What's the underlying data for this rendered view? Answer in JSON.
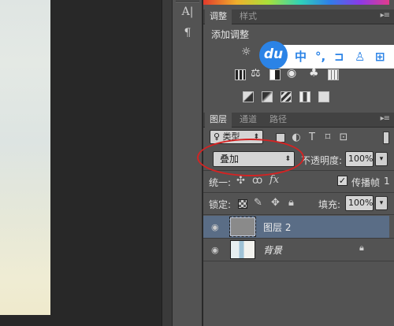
{
  "colors": {
    "panel_bg": "#535353",
    "selected_row": "#5a6d86",
    "annotation": "#d42323",
    "baidu_blue": "#2b83e6"
  },
  "tool_column": {
    "items": [
      {
        "icon": "character-icon",
        "glyph": "A|"
      },
      {
        "icon": "paragraph-icon",
        "glyph": "¶"
      }
    ]
  },
  "adjustments_panel": {
    "tabs": [
      "调整",
      "样式"
    ],
    "title": "添加调整",
    "menu_glyph": "▸≡"
  },
  "baidu_toolbar": {
    "logo": "du",
    "items": [
      {
        "icon": "chinese-input-icon",
        "glyph": "中"
      },
      {
        "icon": "punctuation-icon",
        "glyph": "°,"
      },
      {
        "icon": "cup-icon",
        "glyph": "⊐"
      },
      {
        "icon": "user-icon",
        "glyph": "♙"
      },
      {
        "icon": "grid-icon",
        "glyph": "⊞"
      }
    ]
  },
  "layers_panel": {
    "tabs": [
      "图层",
      "通道",
      "路径"
    ],
    "menu_glyph": "▸≡",
    "filter_kind": "♀ 类型",
    "blend_mode": "叠加",
    "opacity_label": "不透明度:",
    "opacity_value": "100%",
    "unify_label": "统一:",
    "propagate_label": "传播帧",
    "propagate_value": "1",
    "propagate_checked": true,
    "lock_label": "锁定:",
    "fill_label": "填充:",
    "fill_value": "100%",
    "layers": [
      {
        "name": "图层 2",
        "selected": true,
        "visible": true
      },
      {
        "name": "背景",
        "selected": false,
        "visible": true,
        "locked": true
      }
    ]
  }
}
